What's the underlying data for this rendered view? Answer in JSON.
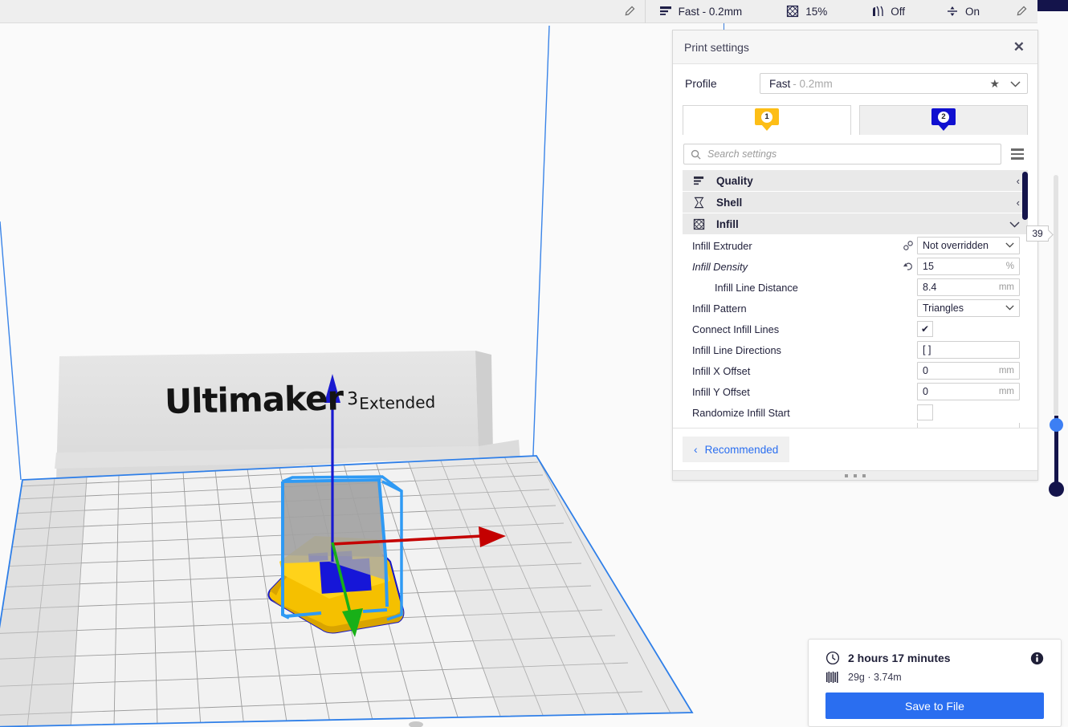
{
  "app": {
    "viewport": {
      "printer_brand": "Ultimaker",
      "printer_model_sup": "3",
      "printer_model_suffix": "Extended"
    }
  },
  "toolbar": {
    "left_pencil_icon": "pencil-icon",
    "items": [
      {
        "icon": "layer-height-icon",
        "label": "Fast - 0.2mm",
        "name": "profile"
      },
      {
        "icon": "infill-icon",
        "label": "15%",
        "name": "infill"
      },
      {
        "icon": "support-icon",
        "label": "Off",
        "name": "support"
      },
      {
        "icon": "adhesion-icon",
        "label": "On",
        "name": "adhesion"
      }
    ],
    "right_pencil_icon": "pencil-icon"
  },
  "print_settings": {
    "title": "Print settings",
    "close_icon": "close-icon",
    "profile": {
      "label": "Profile",
      "value_main": "Fast",
      "value_sub": "- 0.2mm",
      "star_icon": "star-icon",
      "chevron_icon": "chevron-down-icon"
    },
    "extruder_tabs": [
      {
        "number": "1",
        "color": "#fdbe16",
        "active": true
      },
      {
        "number": "2",
        "color": "#1010d0",
        "active": false
      }
    ],
    "search": {
      "placeholder": "Search settings",
      "value": "",
      "icon": "search-icon",
      "menu_icon": "hamburger-icon"
    },
    "categories": [
      {
        "icon": "quality-icon",
        "label": "Quality",
        "arrow": "‹",
        "expanded": false
      },
      {
        "icon": "shell-icon",
        "label": "Shell",
        "arrow": "‹",
        "expanded": false
      },
      {
        "icon": "infill-icon",
        "label": "Infill",
        "arrow": "⌄",
        "expanded": true
      }
    ],
    "rows": [
      {
        "label": "Infill Extruder",
        "icon": "link-icon",
        "type": "select",
        "value": "Not overridden",
        "unit": "",
        "indent": false,
        "italic": false
      },
      {
        "label": "Infill Density",
        "icon": "revert-icon",
        "type": "text",
        "value": "15",
        "unit": "%",
        "indent": false,
        "italic": true
      },
      {
        "label": "Infill Line Distance",
        "icon": "",
        "type": "text",
        "value": "8.4",
        "unit": "mm",
        "indent": true,
        "italic": false
      },
      {
        "label": "Infill Pattern",
        "icon": "",
        "type": "select",
        "value": "Triangles",
        "unit": "",
        "indent": false,
        "italic": false
      },
      {
        "label": "Connect Infill Lines",
        "icon": "",
        "type": "checkbox",
        "value": "✔",
        "unit": "",
        "indent": false,
        "italic": false
      },
      {
        "label": "Infill Line Directions",
        "icon": "",
        "type": "text",
        "value": "[ ]",
        "unit": "",
        "indent": false,
        "italic": false
      },
      {
        "label": "Infill X Offset",
        "icon": "",
        "type": "text",
        "value": "0",
        "unit": "mm",
        "indent": false,
        "italic": false
      },
      {
        "label": "Infill Y Offset",
        "icon": "",
        "type": "text",
        "value": "0",
        "unit": "mm",
        "indent": false,
        "italic": false
      },
      {
        "label": "Randomize Infill Start",
        "icon": "",
        "type": "emptybox",
        "value": "",
        "unit": "",
        "indent": false,
        "italic": false
      }
    ],
    "footer": {
      "recommended_label": "Recommended",
      "back_chevron": "‹"
    }
  },
  "layer_slider": {
    "value": "39",
    "top_handle_color": "#3d7ff4",
    "bottom_handle_color": "#14144b"
  },
  "job_info": {
    "time_icon": "clock-icon",
    "time": "2 hours 17 minutes",
    "info_icon": "info-icon",
    "material_icon": "filament-icon",
    "material": "29g · 3.74m",
    "save_label": "Save to File",
    "accent_color": "#2a6ef0"
  }
}
